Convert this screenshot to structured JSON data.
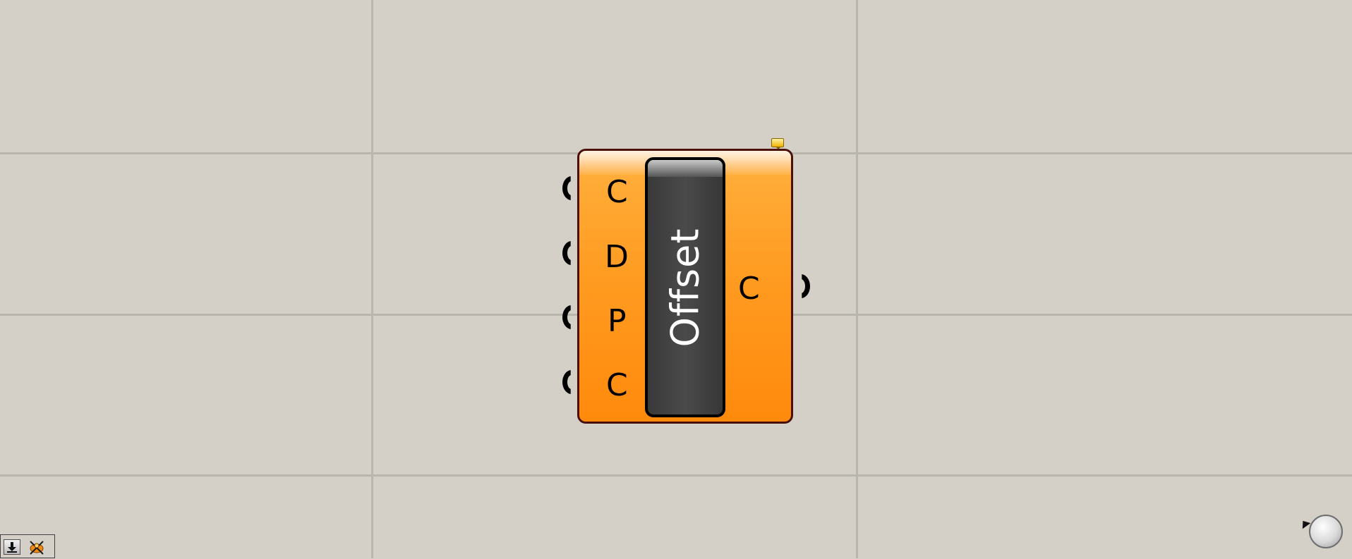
{
  "component": {
    "name": "Offset",
    "inputs": [
      {
        "label": "C"
      },
      {
        "label": "D"
      },
      {
        "label": "P"
      },
      {
        "label": "C"
      }
    ],
    "outputs": [
      {
        "label": "C"
      }
    ],
    "colors": {
      "body": "#ff9c22",
      "border": "#4a0f0a",
      "name_box": "#3e3e3e",
      "name_text": "#ffffff",
      "canvas": "#d4d0c8",
      "grid": "#b9b6ae"
    }
  },
  "toolbar": {
    "buttons": [
      {
        "icon": "download-icon"
      },
      {
        "icon": "grasshopper-icon"
      }
    ]
  },
  "navigator": {
    "icon": "zoom-navigator-icon"
  }
}
